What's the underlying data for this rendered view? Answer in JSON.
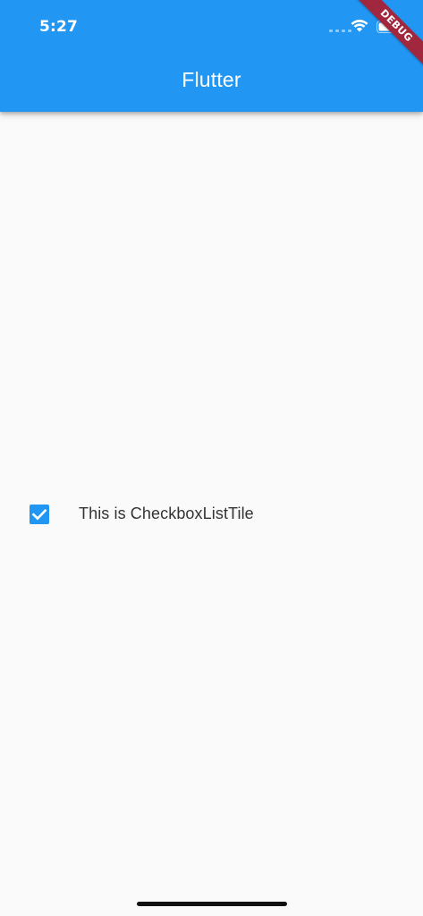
{
  "status_bar": {
    "time": "5:27",
    "icons": [
      "signal-icon",
      "wifi-icon",
      "battery-icon"
    ]
  },
  "debug_banner": {
    "label": "DEBUG"
  },
  "app_bar": {
    "title": "Flutter"
  },
  "checkbox_tile": {
    "label": "This is CheckboxListTile",
    "checked": true
  },
  "colors": {
    "primary": "#2196f3",
    "background": "#fafafa",
    "debug_banner": "#a0273e",
    "text": "#333333"
  }
}
